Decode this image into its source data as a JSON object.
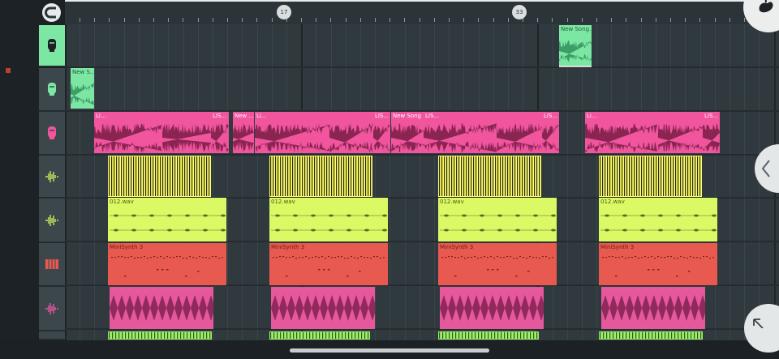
{
  "ruler": {
    "markers": [
      "17",
      "33"
    ]
  },
  "tracks": [
    {
      "icon": "audio-input-icon",
      "active": true
    },
    {
      "icon": "audio-input-icon",
      "active": false
    },
    {
      "icon": "audio-input-icon",
      "active": false
    },
    {
      "icon": "waveform-icon",
      "active": false
    },
    {
      "icon": "waveform-icon",
      "active": false
    },
    {
      "icon": "piano-keys-icon",
      "active": false
    },
    {
      "icon": "waveform-icon",
      "active": false
    }
  ],
  "clips": {
    "new_song_top": "New Song...",
    "new_s": "New S...",
    "li": "Li...",
    "lis": "LIS...",
    "new": "New ...",
    "new_song": "New Song ...",
    "lis_dots": "LIS...",
    "wav": "012.wav",
    "minisynth": "MiniSynth 3"
  },
  "colors": {
    "green": "#7ce7a3",
    "pink": "#f0559e",
    "yellow": "#ffff66",
    "lime": "#dbf964",
    "red": "#e8594f",
    "magenta": "#e6589c",
    "pattern_green": "#9eef6c"
  }
}
